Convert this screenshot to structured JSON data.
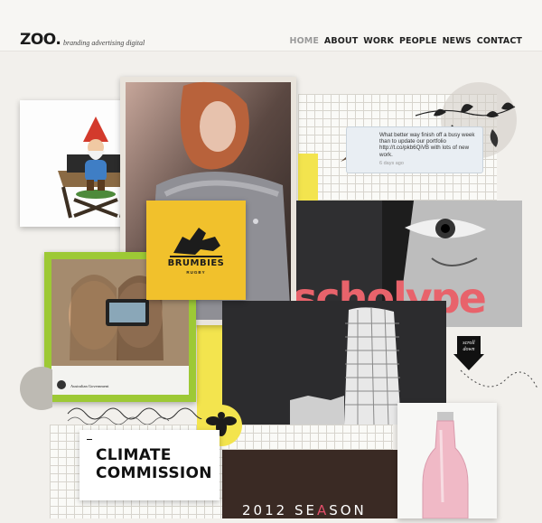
{
  "header": {
    "logo": "ZOO.",
    "tagline": "branding advertising digital",
    "nav": [
      {
        "label": "HOME",
        "active": true
      },
      {
        "label": "ABOUT",
        "active": false
      },
      {
        "label": "WORK",
        "active": false
      },
      {
        "label": "PEOPLE",
        "active": false
      },
      {
        "label": "NEWS",
        "active": false
      },
      {
        "label": "CONTACT",
        "active": false
      }
    ]
  },
  "tweet": {
    "text": "What better way finish off a busy week than to update our portfolio http://t.co/pkb6QiVB with lots of new work.",
    "time": "6 days ago"
  },
  "brumbies": {
    "name": "BRUMBIES",
    "sub": "RUGBY"
  },
  "australian_gov": "Australian Government",
  "climate": {
    "line1": "CLIMATE",
    "line2": "COMMISSION"
  },
  "scroll": {
    "line1": "scroll",
    "line2": "down"
  },
  "season": {
    "part1": "2012 SE",
    "part2": "A",
    "part3": "SON"
  },
  "colors": {
    "yellow": "#f3e44e",
    "brumbies": "#f1c12c",
    "lime": "#9dc935",
    "pink": "#e24e6a",
    "dark": "#2f2f31"
  }
}
